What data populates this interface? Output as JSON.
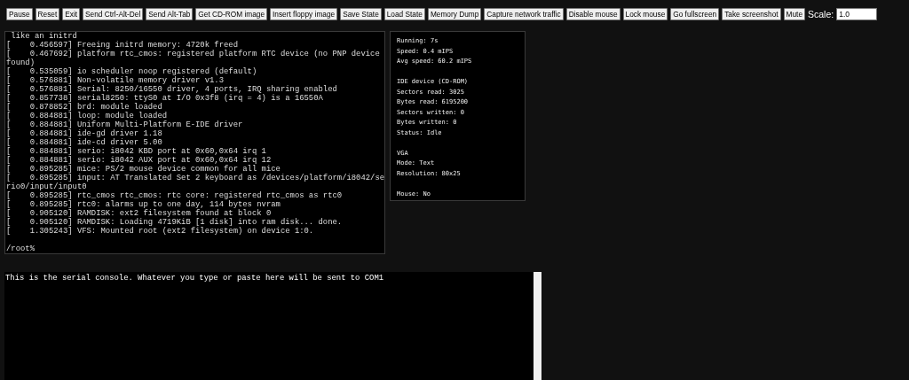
{
  "toolbar": {
    "buttons": [
      "Pause",
      "Reset",
      "Exit",
      "Send Ctrl-Alt-Del",
      "Send Alt-Tab",
      "Get CD-ROM image",
      "Insert floppy image",
      "Save State",
      "Load State",
      "Memory Dump",
      "Capture network traffic",
      "Disable mouse",
      "Lock mouse",
      "Go fullscreen",
      "Take screenshot",
      "Mute"
    ],
    "scale_label": "Scale:",
    "scale_value": "1.0"
  },
  "screen": {
    "lines": [
      " like an initrd",
      "[    0.456597] Freeing initrd memory: 4720k freed",
      "[    0.467692] platform rtc_cmos: registered platform RTC device (no PNP device",
      "found)",
      "[    0.535059] io scheduler noop registered (default)",
      "[    0.576881] Non-volatile memory driver v1.3",
      "[    0.576881] Serial: 8250/16550 driver, 4 ports, IRQ sharing enabled",
      "[    0.857738] serial8250: ttyS0 at I/O 0x3f8 (irq = 4) is a 16550A",
      "[    0.878852] brd: module loaded",
      "[    0.884881] loop: module loaded",
      "[    0.884881] Uniform Multi-Platform E-IDE driver",
      "[    0.884881] ide-gd driver 1.18",
      "[    0.884881] ide-cd driver 5.00",
      "[    0.884881] serio: i8042 KBD port at 0x60,0x64 irq 1",
      "[    0.884881] serio: i8042 AUX port at 0x60,0x64 irq 12",
      "[    0.895285] mice: PS/2 mouse device common for all mice",
      "[    0.895285] input: AT Translated Set 2 keyboard as /devices/platform/i8042/se",
      "rio0/input/input0",
      "[    0.895285] rtc_cmos rtc_cmos: rtc core: registered rtc_cmos as rtc0",
      "[    0.895285] rtc0: alarms up to one day, 114 bytes nvram",
      "[    0.905120] RAMDISK: ext2 filesystem found at block 0",
      "[    0.905120] RAMDISK: Loading 4719KiB [1 disk] into ram disk... done.",
      "[    1.305243] VFS: Mounted root (ext2 filesystem) on device 1:0."
    ],
    "prompt": "/root%"
  },
  "stats": [
    {
      "lines": [
        "Running: 7s",
        "Speed: 0.4 mIPS",
        "Avg speed: 60.2 mIPS"
      ]
    },
    {
      "lines": [
        "IDE device (CD-ROM)",
        "Sectors read: 3025",
        "Bytes read: 6195200",
        "Sectors written: 0",
        "Bytes written: 0",
        "Status: Idle"
      ]
    },
    {
      "lines": [
        "VGA",
        "Mode: Text",
        "Resolution: 80x25"
      ]
    },
    {
      "lines": [
        "Mouse: No"
      ]
    }
  ],
  "serial_console": {
    "value": "This is the serial console. Whatever you type or paste here will be sent to COM1"
  }
}
